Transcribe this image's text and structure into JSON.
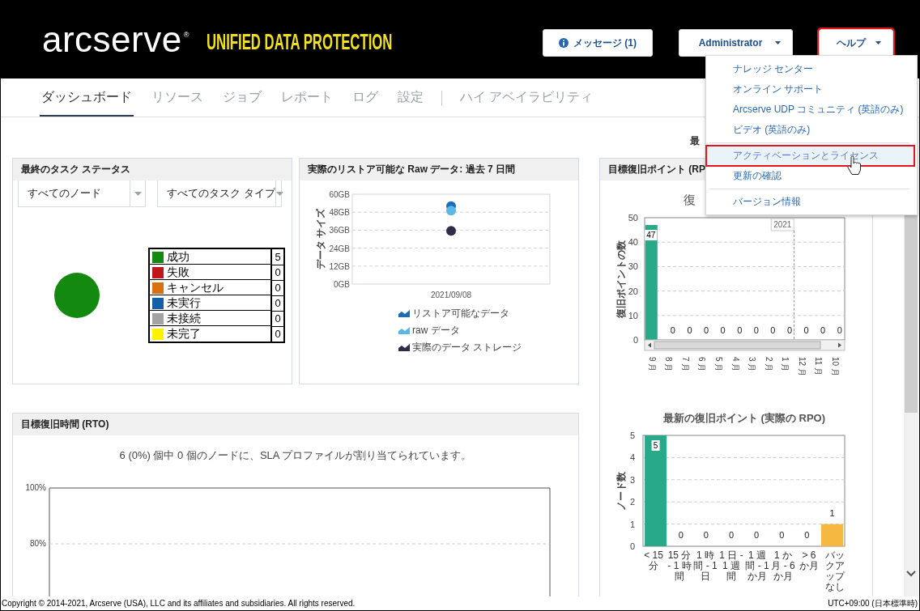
{
  "header": {
    "logo": "arcserve",
    "logo_mark": "®",
    "product": "UNIFIED DATA PROTECTION",
    "buttons": [
      {
        "kind": "messages",
        "label": "メッセージ (1)",
        "highlighted": false
      },
      {
        "kind": "dropdown",
        "label": "Administrator",
        "highlighted": false
      },
      {
        "kind": "dropdown",
        "label": "ヘルプ",
        "highlighted": true
      }
    ]
  },
  "nav": {
    "tabs": [
      {
        "label": "ダッシュボード",
        "selected": true,
        "divider_before": false
      },
      {
        "label": "リソース",
        "selected": false,
        "divider_before": false
      },
      {
        "label": "ジョブ",
        "selected": false,
        "divider_before": false
      },
      {
        "label": "レポート",
        "selected": false,
        "divider_before": false
      },
      {
        "label": "ログ",
        "selected": false,
        "divider_before": false
      },
      {
        "label": "設定",
        "selected": false,
        "divider_before": false
      },
      {
        "label": "ハイ アベイラビリティ",
        "selected": false,
        "divider_before": true
      }
    ]
  },
  "help_menu": {
    "items": [
      {
        "label": "ナレッジ センター",
        "hovered": false,
        "divider_before": false
      },
      {
        "label": "オンライン サポート",
        "hovered": false,
        "divider_before": false
      },
      {
        "label": "Arcserve UDP コミュニティ (英語のみ)",
        "hovered": false,
        "divider_before": false
      },
      {
        "label": "ビデオ (英語のみ)",
        "hovered": false,
        "divider_before": false
      },
      {
        "label": "アクティベーションとライセンス",
        "hovered": true,
        "divider_before": true
      },
      {
        "label": "更新の確認",
        "hovered": false,
        "divider_before": false
      },
      {
        "label": "バージョン情報",
        "hovered": false,
        "divider_before": true
      }
    ]
  },
  "task_status": {
    "title": "最終のタスク ステータス",
    "filters": [
      {
        "value": "すべてのノード"
      },
      {
        "value": "すべてのタスク タイプ"
      }
    ],
    "legend": [
      {
        "label": "成功",
        "color": "#138a0f",
        "count": "5"
      },
      {
        "label": "失敗",
        "color": "#c0171c",
        "count": "0"
      },
      {
        "label": "キャンセル",
        "color": "#d9700f",
        "count": "0"
      },
      {
        "label": "未実行",
        "color": "#125fa8",
        "count": "0"
      },
      {
        "label": "未接続",
        "color": "#a3a3a3",
        "count": "0"
      },
      {
        "label": "未完了",
        "color": "#fff200",
        "count": "0"
      }
    ]
  },
  "restore_data": {
    "title": "実際のリストア可能な Raw データ: 過去 7 日間",
    "chart_data": {
      "type": "scatter",
      "ylabel": "データ サイズ",
      "categories": [
        "2021/09/08"
      ],
      "ylim": [
        0,
        60
      ],
      "grid": true,
      "legend": true,
      "yticks": [
        {
          "value": 0,
          "label": "0GB"
        },
        {
          "value": 12,
          "label": "12GB"
        },
        {
          "value": 24,
          "label": "24GB"
        },
        {
          "value": 36,
          "label": "36GB"
        },
        {
          "value": 48,
          "label": "48GB"
        },
        {
          "value": 60,
          "label": "60GB"
        }
      ],
      "series": [
        {
          "name": "リストア可能なデータ",
          "color": "#1c6db5",
          "values": [
            52
          ]
        },
        {
          "name": "raw データ",
          "color": "#5bb8e6",
          "values": [
            49
          ]
        },
        {
          "name": "実際のデータ ストレージ",
          "color": "#2e2c48",
          "values": [
            35.5
          ]
        }
      ]
    }
  },
  "rpo": {
    "heading_fragment": "最",
    "title": "目標復旧ポイント (RP",
    "target_chart": {
      "title": "復",
      "chart_data": {
        "type": "bar",
        "ylabel": "復旧ポイントの数",
        "categories": [
          "9 月",
          "8 月",
          "7 月",
          "6 月",
          "5 月",
          "4 月",
          "3 月",
          "2 月",
          "1 月",
          "12 月",
          "11 月",
          "10 月"
        ],
        "ylim": [
          0,
          50
        ],
        "yticks": [
          0,
          10,
          20,
          30,
          40,
          50
        ],
        "data_labels": true,
        "grid": true,
        "series": [
          {
            "color": "#27a98a",
            "values": [
              47,
              0,
              0,
              0,
              0,
              0,
              0,
              0,
              0,
              0,
              0,
              0
            ]
          }
        ],
        "annotations": [
          {
            "text": "2021"
          }
        ]
      }
    },
    "latest_chart": {
      "title": "最新の復旧ポイント (実際の RPO)",
      "chart_data": {
        "type": "bar",
        "ylabel": "ノード数",
        "categories": [
          "< 15 分",
          "15 分 - 1 時間",
          "1 時間 - 1 日",
          "1 日 - 1 週間",
          "1 週間 - 1 か月",
          "1 か月 - 6 か月",
          "> 6 か月",
          "バックアップなし"
        ],
        "ylim": [
          0,
          5
        ],
        "yticks": [
          0,
          1,
          2,
          3,
          4,
          5
        ],
        "stacked": true,
        "data_labels": true,
        "grid": true,
        "series": [
          {
            "color": "#27a98a",
            "values": [
              5,
              0,
              0,
              0,
              0,
              0,
              0,
              null
            ]
          },
          {
            "color": "#f5b942",
            "values": [
              null,
              null,
              null,
              null,
              null,
              null,
              null,
              1
            ]
          }
        ]
      }
    }
  },
  "rto": {
    "title": "目標復旧時間 (RTO)",
    "summary": "6 (0%) 個中 0 個のノードに、SLA プロファイルが割り当てられています。",
    "axis_labels": [
      "100%",
      "80%"
    ]
  },
  "footer": {
    "copyright": "Copyright © 2014-2021, Arcserve (USA), LLC and its affiliates and subsidiaries. All rights reserved.",
    "timezone": "UTC+09:00 (日本標準時)"
  }
}
